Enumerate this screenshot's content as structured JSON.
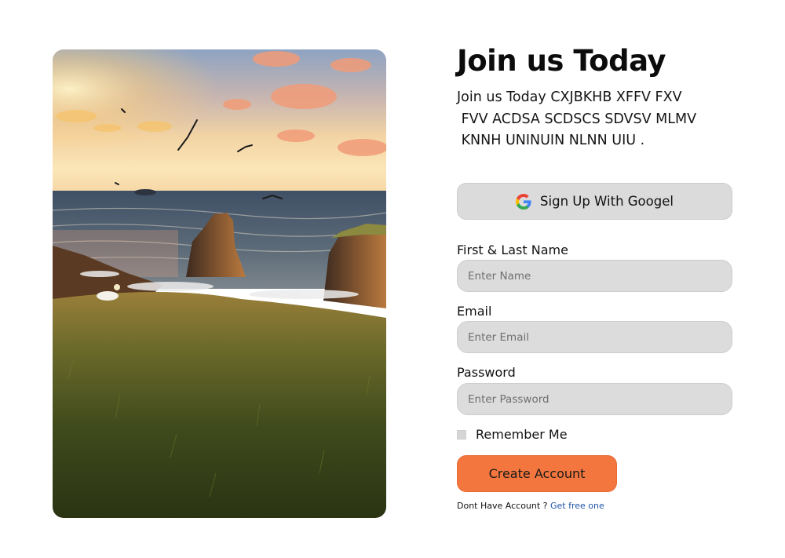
{
  "hero": {
    "image_alt": "Coastal cliffs at sunset with seabirds and grassy hillside"
  },
  "header": {
    "title": "Join us Today",
    "description_lines": [
      "Join us Today CXJBKHB XFFV FXV",
      " FVV ACDSA SCDSCS SDVSV MLMV",
      " KNNH UNINUIN NLNN UIU ."
    ]
  },
  "google_signup": {
    "label": "Sign Up With Googel",
    "icon": "google-icon"
  },
  "form": {
    "name": {
      "label": "First & Last Name",
      "placeholder": "Enter Name",
      "value": ""
    },
    "email": {
      "label": "Email",
      "placeholder": "Enter Email",
      "value": ""
    },
    "password": {
      "label": "Password",
      "placeholder": "Enter Password",
      "value": ""
    },
    "remember": {
      "label": "Remember Me",
      "checked": false
    },
    "submit_label": "Create Account"
  },
  "footer": {
    "prompt": "Dont Have Account ? ",
    "link_label": "Get free one"
  },
  "colors": {
    "accent": "#f3763e",
    "field_bg": "#dcdcdc",
    "link": "#1f55a8"
  }
}
